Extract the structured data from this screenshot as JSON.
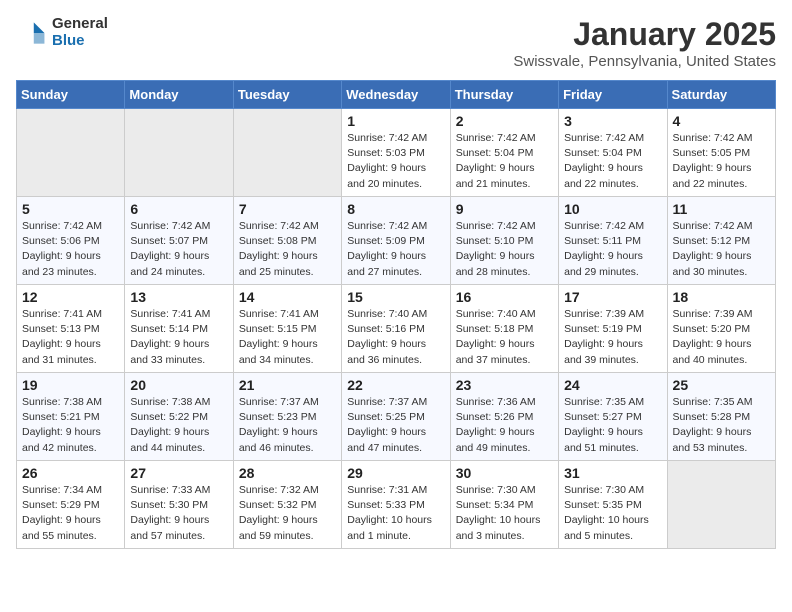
{
  "header": {
    "logo_general": "General",
    "logo_blue": "Blue",
    "month_title": "January 2025",
    "location": "Swissvale, Pennsylvania, United States"
  },
  "weekdays": [
    "Sunday",
    "Monday",
    "Tuesday",
    "Wednesday",
    "Thursday",
    "Friday",
    "Saturday"
  ],
  "weeks": [
    [
      {
        "day": "",
        "empty": true
      },
      {
        "day": "",
        "empty": true
      },
      {
        "day": "",
        "empty": true
      },
      {
        "day": "1",
        "sunrise": "7:42 AM",
        "sunset": "5:03 PM",
        "daylight": "9 hours and 20 minutes."
      },
      {
        "day": "2",
        "sunrise": "7:42 AM",
        "sunset": "5:04 PM",
        "daylight": "9 hours and 21 minutes."
      },
      {
        "day": "3",
        "sunrise": "7:42 AM",
        "sunset": "5:04 PM",
        "daylight": "9 hours and 22 minutes."
      },
      {
        "day": "4",
        "sunrise": "7:42 AM",
        "sunset": "5:05 PM",
        "daylight": "9 hours and 22 minutes."
      }
    ],
    [
      {
        "day": "5",
        "sunrise": "7:42 AM",
        "sunset": "5:06 PM",
        "daylight": "9 hours and 23 minutes."
      },
      {
        "day": "6",
        "sunrise": "7:42 AM",
        "sunset": "5:07 PM",
        "daylight": "9 hours and 24 minutes."
      },
      {
        "day": "7",
        "sunrise": "7:42 AM",
        "sunset": "5:08 PM",
        "daylight": "9 hours and 25 minutes."
      },
      {
        "day": "8",
        "sunrise": "7:42 AM",
        "sunset": "5:09 PM",
        "daylight": "9 hours and 27 minutes."
      },
      {
        "day": "9",
        "sunrise": "7:42 AM",
        "sunset": "5:10 PM",
        "daylight": "9 hours and 28 minutes."
      },
      {
        "day": "10",
        "sunrise": "7:42 AM",
        "sunset": "5:11 PM",
        "daylight": "9 hours and 29 minutes."
      },
      {
        "day": "11",
        "sunrise": "7:42 AM",
        "sunset": "5:12 PM",
        "daylight": "9 hours and 30 minutes."
      }
    ],
    [
      {
        "day": "12",
        "sunrise": "7:41 AM",
        "sunset": "5:13 PM",
        "daylight": "9 hours and 31 minutes."
      },
      {
        "day": "13",
        "sunrise": "7:41 AM",
        "sunset": "5:14 PM",
        "daylight": "9 hours and 33 minutes."
      },
      {
        "day": "14",
        "sunrise": "7:41 AM",
        "sunset": "5:15 PM",
        "daylight": "9 hours and 34 minutes."
      },
      {
        "day": "15",
        "sunrise": "7:40 AM",
        "sunset": "5:16 PM",
        "daylight": "9 hours and 36 minutes."
      },
      {
        "day": "16",
        "sunrise": "7:40 AM",
        "sunset": "5:18 PM",
        "daylight": "9 hours and 37 minutes."
      },
      {
        "day": "17",
        "sunrise": "7:39 AM",
        "sunset": "5:19 PM",
        "daylight": "9 hours and 39 minutes."
      },
      {
        "day": "18",
        "sunrise": "7:39 AM",
        "sunset": "5:20 PM",
        "daylight": "9 hours and 40 minutes."
      }
    ],
    [
      {
        "day": "19",
        "sunrise": "7:38 AM",
        "sunset": "5:21 PM",
        "daylight": "9 hours and 42 minutes."
      },
      {
        "day": "20",
        "sunrise": "7:38 AM",
        "sunset": "5:22 PM",
        "daylight": "9 hours and 44 minutes."
      },
      {
        "day": "21",
        "sunrise": "7:37 AM",
        "sunset": "5:23 PM",
        "daylight": "9 hours and 46 minutes."
      },
      {
        "day": "22",
        "sunrise": "7:37 AM",
        "sunset": "5:25 PM",
        "daylight": "9 hours and 47 minutes."
      },
      {
        "day": "23",
        "sunrise": "7:36 AM",
        "sunset": "5:26 PM",
        "daylight": "9 hours and 49 minutes."
      },
      {
        "day": "24",
        "sunrise": "7:35 AM",
        "sunset": "5:27 PM",
        "daylight": "9 hours and 51 minutes."
      },
      {
        "day": "25",
        "sunrise": "7:35 AM",
        "sunset": "5:28 PM",
        "daylight": "9 hours and 53 minutes."
      }
    ],
    [
      {
        "day": "26",
        "sunrise": "7:34 AM",
        "sunset": "5:29 PM",
        "daylight": "9 hours and 55 minutes."
      },
      {
        "day": "27",
        "sunrise": "7:33 AM",
        "sunset": "5:30 PM",
        "daylight": "9 hours and 57 minutes."
      },
      {
        "day": "28",
        "sunrise": "7:32 AM",
        "sunset": "5:32 PM",
        "daylight": "9 hours and 59 minutes."
      },
      {
        "day": "29",
        "sunrise": "7:31 AM",
        "sunset": "5:33 PM",
        "daylight": "10 hours and 1 minute."
      },
      {
        "day": "30",
        "sunrise": "7:30 AM",
        "sunset": "5:34 PM",
        "daylight": "10 hours and 3 minutes."
      },
      {
        "day": "31",
        "sunrise": "7:30 AM",
        "sunset": "5:35 PM",
        "daylight": "10 hours and 5 minutes."
      },
      {
        "day": "",
        "empty": true
      }
    ]
  ],
  "labels": {
    "sunrise_prefix": "Sunrise: ",
    "sunset_prefix": "Sunset: ",
    "daylight_prefix": "Daylight: "
  }
}
